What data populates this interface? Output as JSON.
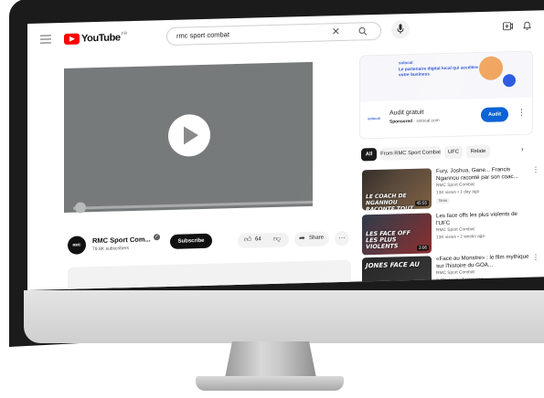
{
  "header": {
    "logo_text": "YouTube",
    "logo_region": "FR",
    "search_query": "rmc sport combat",
    "clear_glyph": "✕"
  },
  "video": {
    "channel_avatar": "RMC SPORT",
    "channel_name": "RMC Sport Com...",
    "subscribers": "79.8K subscribers",
    "subscribe_label": "Subscribe",
    "like_count": "64",
    "share_label": "Share",
    "progress": 0.03
  },
  "ad": {
    "brand": "solocal",
    "tagline": "Le partenaire digital local qui accélère votre business",
    "logo": "solocal",
    "title": "Audit gratuit",
    "sponsored": "Sponsored",
    "domain": "solocal.com",
    "cta": "Audit"
  },
  "chips": [
    "All",
    "From RMC Sport Combat",
    "UFC",
    "Relate"
  ],
  "recommendations": [
    {
      "title": "Fury, Joshua, Gane... Francis Ngannou raconté par son coac...",
      "channel": "RMC Sport Combat",
      "meta": "13K views • 1 day ago",
      "badge": "New",
      "duration": "45:55",
      "thumb_caption": "LE COACH DE NGANNOU RACONTE TOUT",
      "thumb_colors": [
        "#2a2420",
        "#7a5a3a"
      ]
    },
    {
      "title": "Les face offs les plus violents de l'UFC",
      "channel": "RMC Sport Combat",
      "meta": "13K views • 2 weeks ago",
      "badge": "",
      "duration": "3:06",
      "thumb_caption": "LES FACE OFF LES PLUS VIOLENTS",
      "thumb_colors": [
        "#1d2a3a",
        "#8a2a2a"
      ]
    },
    {
      "title": "«Face au Monstre» : le film mythique sur l'histoire du GOA...",
      "channel": "RMC Sport Combat",
      "meta": "3.4M views • 1 year ago",
      "badge": "",
      "duration": "",
      "thumb_caption": "JONES FACE AU",
      "thumb_colors": [
        "#141414",
        "#3a3a3a"
      ]
    }
  ],
  "colors": {
    "brand_red": "#ff0000",
    "cta_blue": "#065fd4",
    "player_gray": "#777a7b"
  }
}
